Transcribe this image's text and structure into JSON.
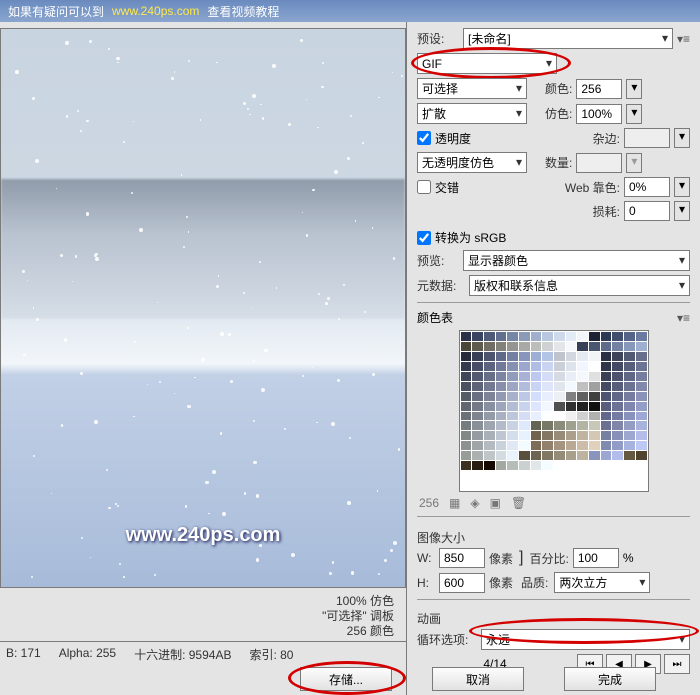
{
  "topbar": {
    "t1": "如果有疑问可以到",
    "url": "www.240ps.com",
    "t2": "查看视频教程"
  },
  "preset": {
    "label": "预设:",
    "value": "[未命名]"
  },
  "format": {
    "value": "GIF"
  },
  "reduction": {
    "value": "可选择"
  },
  "dither": {
    "value": "扩散"
  },
  "transparency": {
    "label": "透明度",
    "checked": true
  },
  "notransdither": {
    "value": "无透明度仿色"
  },
  "interlaced": {
    "label": "交错",
    "checked": false
  },
  "colors": {
    "label": "颜色:",
    "value": "256"
  },
  "ditherpct": {
    "label": "仿色:",
    "value": "100%"
  },
  "matte": {
    "label": "杂边:"
  },
  "amount": {
    "label": "数量:"
  },
  "websnap": {
    "label": "Web 靠色:",
    "value": "0%"
  },
  "lossy": {
    "label": "损耗:",
    "value": "0"
  },
  "srgb": {
    "label": "转换为 sRGB",
    "checked": true
  },
  "previewsel": {
    "label": "预览:",
    "value": "显示器颜色"
  },
  "metadata": {
    "label": "元数据:",
    "value": "版权和联系信息"
  },
  "colortable": {
    "label": "颜色表",
    "count": "256"
  },
  "imagesize": {
    "label": "图像大小",
    "w_lbl": "W:",
    "w": "850",
    "h_lbl": "H:",
    "h": "600",
    "px": "像素",
    "pct_lbl": "百分比:",
    "pct": "100",
    "pct_sym": "%",
    "quality_lbl": "品质:",
    "quality": "两次立方"
  },
  "anim": {
    "label": "动画",
    "loop_lbl": "循环选项:",
    "loop": "永远",
    "frame": "4/14"
  },
  "previewinfo": {
    "line1": "100% 仿色",
    "line2": "\"可选择\" 调板",
    "line3": "256 颜色"
  },
  "status": {
    "b": "B: 171",
    "alpha": "Alpha: 255",
    "hex": "十六进制: 9594AB",
    "idx": "索引: 80"
  },
  "buttons": {
    "save": "存储...",
    "cancel": "取消",
    "done": "完成"
  },
  "watermark": "www.240ps.com",
  "colortable_cells": [
    "#2a3048",
    "#3a4460",
    "#4d5a78",
    "#627090",
    "#7686a6",
    "#8a9ab8",
    "#a0b0cc",
    "#b8c6de",
    "#cedaec",
    "#e2eaf5",
    "#f2f6fb",
    "#1c2234",
    "#2e3953",
    "#414d6d",
    "#556486",
    "#6a7aa0",
    "#4a4638",
    "#5d5a4e",
    "#706e64",
    "#83827a",
    "#969690",
    "#a9aaa6",
    "#bcbebc",
    "#cfd2d2",
    "#e2e6e8",
    "#f5f9fb",
    "#374058",
    "#4a5570",
    "#5e6b8a",
    "#7381a2",
    "#8898ba",
    "#9db0d0",
    "#262b3c",
    "#393f54",
    "#4c546e",
    "#606a88",
    "#7480a2",
    "#8996bc",
    "#9eaed4",
    "#b4c4e6",
    "#c0c5cd",
    "#d3d8e0",
    "#e6ebf3",
    "#f2f4f8",
    "#2b3042",
    "#3e445a",
    "#525972",
    "#676f8c",
    "#353a4e",
    "#484e66",
    "#5c637e",
    "#717998",
    "#8690b2",
    "#9ba7cc",
    "#b1bee4",
    "#c8d4f2",
    "#cbd0d8",
    "#dee3eb",
    "#f1f6fe",
    "#fefefe",
    "#30354a",
    "#434962",
    "#575e7a",
    "#6c7494",
    "#404558",
    "#535970",
    "#676e88",
    "#7c84a2",
    "#919bbc",
    "#a7b2d6",
    "#bdc8ee",
    "#d4dcf6",
    "#d6dbe3",
    "#e9eef6",
    "#f4f8fc",
    "#e0e0e0",
    "#3a3f56",
    "#4d536e",
    "#616886",
    "#767ea0",
    "#4b5060",
    "#5e6478",
    "#727990",
    "#878faa",
    "#9ca6c4",
    "#b2bdde",
    "#c8d3f6",
    "#dee5fa",
    "#e1e6ee",
    "#f4f9ff",
    "#c0c0c0",
    "#a0a0a0",
    "#444964",
    "#575d7a",
    "#6b7292",
    "#8088ac",
    "#565b68",
    "#696f80",
    "#7d8498",
    "#929ab2",
    "#a7b1cc",
    "#bdc8e6",
    "#d3ddfc",
    "#e8eefe",
    "#eceff4",
    "#808080",
    "#606060",
    "#404040",
    "#4e5372",
    "#616788",
    "#757ca0",
    "#8a92ba",
    "#616670",
    "#747a88",
    "#888fa0",
    "#9da5ba",
    "#b2bcd4",
    "#c8d3ee",
    "#dee6ff",
    "#f2f6ff",
    "#505050",
    "#303030",
    "#202020",
    "#101010",
    "#585d80",
    "#6b7296",
    "#7f87ae",
    "#949dc8",
    "#6c7178",
    "#7f8590",
    "#939aa8",
    "#a8b0c2",
    "#bdc7dc",
    "#d3def6",
    "#e8efff",
    "#fbfdff",
    "#ffffff",
    "#f0f0f0",
    "#d0d0d0",
    "#b0b0b0",
    "#62678e",
    "#757ca4",
    "#8992bc",
    "#9ea8d6",
    "#777c80",
    "#8a9098",
    "#9ea5b0",
    "#b3bbca",
    "#c8d2e4",
    "#dee9fe",
    "#646454",
    "#787868",
    "#8c8c7c",
    "#a0a090",
    "#b4b4a4",
    "#c8c8b8",
    "#6c7194",
    "#7f86aa",
    "#939cc2",
    "#a8b2dc",
    "#828788",
    "#959ba0",
    "#a9b0b8",
    "#bec6d2",
    "#d3ddec",
    "#e8f2ff",
    "#706450",
    "#847864",
    "#988c78",
    "#aca08c",
    "#c0b4a0",
    "#d4c8b4",
    "#7681a2",
    "#8991b8",
    "#9ea7d0",
    "#b4bdea",
    "#8d9290",
    "#a0a6a8",
    "#b4bbc0",
    "#c9d1da",
    "#dfe8f4",
    "#f4fbff",
    "#7c6c58",
    "#90806c",
    "#a49480",
    "#b8a894",
    "#ccbca8",
    "#e0d0bc",
    "#808bb0",
    "#939cc6",
    "#a8b2de",
    "#bec8f4",
    "#989d98",
    "#abb1b0",
    "#bfc6c8",
    "#d4dce2",
    "#eaf3fc",
    "#58503c",
    "#6c6450",
    "#807864",
    "#948c78",
    "#a8a08c",
    "#bcb4a0",
    "#8a95be",
    "#9da7d4",
    "#b2bdec",
    "#645840",
    "#504430",
    "#3c3020",
    "#281c10",
    "#140800",
    "#a3a8a0",
    "#b6bcb8",
    "#cad1d0",
    "#dfe7e8",
    "#f4fcff"
  ]
}
